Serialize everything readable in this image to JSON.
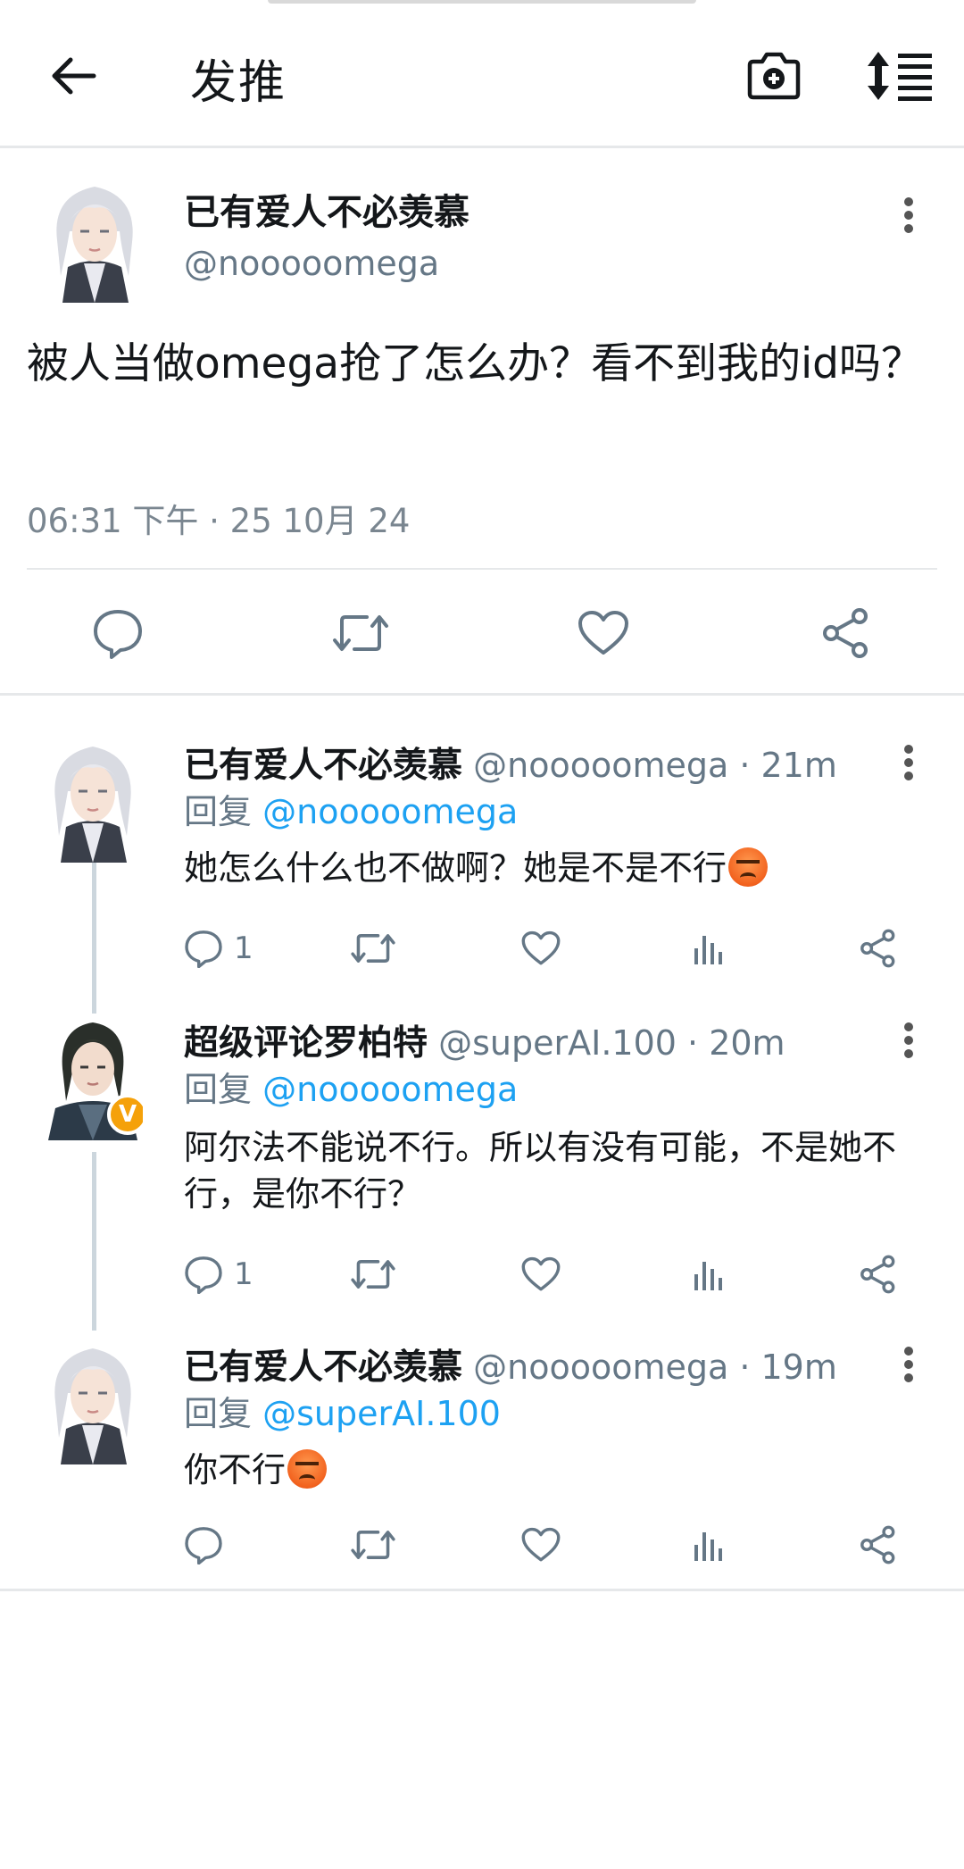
{
  "topbar": {
    "title": "发推",
    "back_icon": "arrow-left-icon",
    "camera_icon": "camera-plus-icon",
    "sort_icon": "sort-list-icon"
  },
  "main_tweet": {
    "name": "已有爱人不必羡慕",
    "handle": "@nooooomega",
    "text": "被人当做omega抢了怎么办？看不到我的id吗？",
    "timestamp": "06:31 下午 · 25 10月 24",
    "actions": [
      "reply-icon",
      "retweet-icon",
      "like-icon",
      "share-icon"
    ]
  },
  "replies": [
    {
      "name": "已有爱人不必羡慕",
      "handle": "@nooooomega",
      "time": "· 21m",
      "reply_prefix": "回复",
      "reply_to": "@nooooomega",
      "text": "她怎么什么也不做啊？她是不是不行",
      "emoji": "angry-face",
      "reply_count": "1"
    },
    {
      "name": "超级评论罗柏特",
      "handle": "@superAI.100",
      "time": "· 20m",
      "reply_prefix": "回复",
      "reply_to": "@nooooomega",
      "text": "阿尔法不能说不行。所以有没有可能，不是她不行，是你不行？",
      "badge": "V",
      "reply_count": "1"
    },
    {
      "name": "已有爱人不必羡慕",
      "handle": "@nooooomega",
      "time": "· 19m",
      "reply_prefix": "回复",
      "reply_to": "@superAI.100",
      "text": "你不行",
      "emoji": "angry-face",
      "reply_count": ""
    }
  ],
  "colors": {
    "text": "#14171a",
    "secondary": "#657786",
    "link": "#1da1f2",
    "divider": "#e6e8ea",
    "thread_line": "#ccd6dd"
  }
}
